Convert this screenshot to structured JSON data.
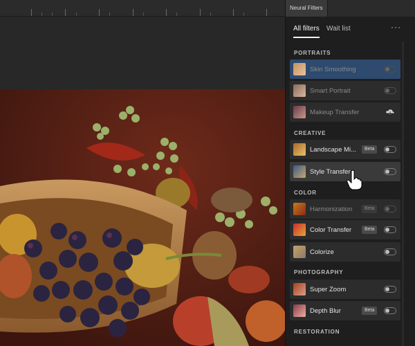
{
  "panel": {
    "title": "Neural Filters",
    "tabs": [
      {
        "label": "All filters",
        "active": true
      },
      {
        "label": "Wait list",
        "active": false
      }
    ],
    "more_icon": "more-horizontal-icon",
    "sections": [
      {
        "label": "PORTRAITS",
        "filters": [
          {
            "name": "Skin Smoothing",
            "badge": "",
            "control": "toggle",
            "state": "selected",
            "enabled": false
          },
          {
            "name": "Smart Portrait",
            "badge": "",
            "control": "toggle",
            "state": "normal",
            "enabled": false
          },
          {
            "name": "Makeup Transfer",
            "badge": "",
            "control": "cloud-download",
            "state": "normal",
            "enabled": false
          }
        ]
      },
      {
        "label": "CREATIVE",
        "filters": [
          {
            "name": "Landscape Mi...",
            "badge": "Beta",
            "control": "toggle",
            "state": "normal",
            "enabled": true
          },
          {
            "name": "Style Transfer",
            "badge": "",
            "control": "toggle",
            "state": "hover",
            "enabled": true
          }
        ]
      },
      {
        "label": "COLOR",
        "filters": [
          {
            "name": "Harmonization",
            "badge": "Beta",
            "control": "toggle",
            "state": "normal",
            "enabled": false
          },
          {
            "name": "Color Transfer",
            "badge": "Beta",
            "control": "toggle",
            "state": "normal",
            "enabled": true
          },
          {
            "name": "Colorize",
            "badge": "",
            "control": "toggle",
            "state": "normal",
            "enabled": true
          }
        ]
      },
      {
        "label": "PHOTOGRAPHY",
        "filters": [
          {
            "name": "Super Zoom",
            "badge": "",
            "control": "toggle",
            "state": "normal",
            "enabled": true
          },
          {
            "name": "Depth Blur",
            "badge": "Beta",
            "control": "toggle",
            "state": "normal",
            "enabled": true
          }
        ]
      },
      {
        "label": "RESTORATION",
        "filters": []
      }
    ]
  },
  "canvas": {
    "image_subject": "fruit-bowl-photo"
  },
  "colors": {
    "panel_bg": "#1e1e1e",
    "row_bg": "#2c2c2c",
    "selected_row": "#2e4a6e",
    "hover_row": "#3a3a3a",
    "canvas_bg": "#262626"
  }
}
